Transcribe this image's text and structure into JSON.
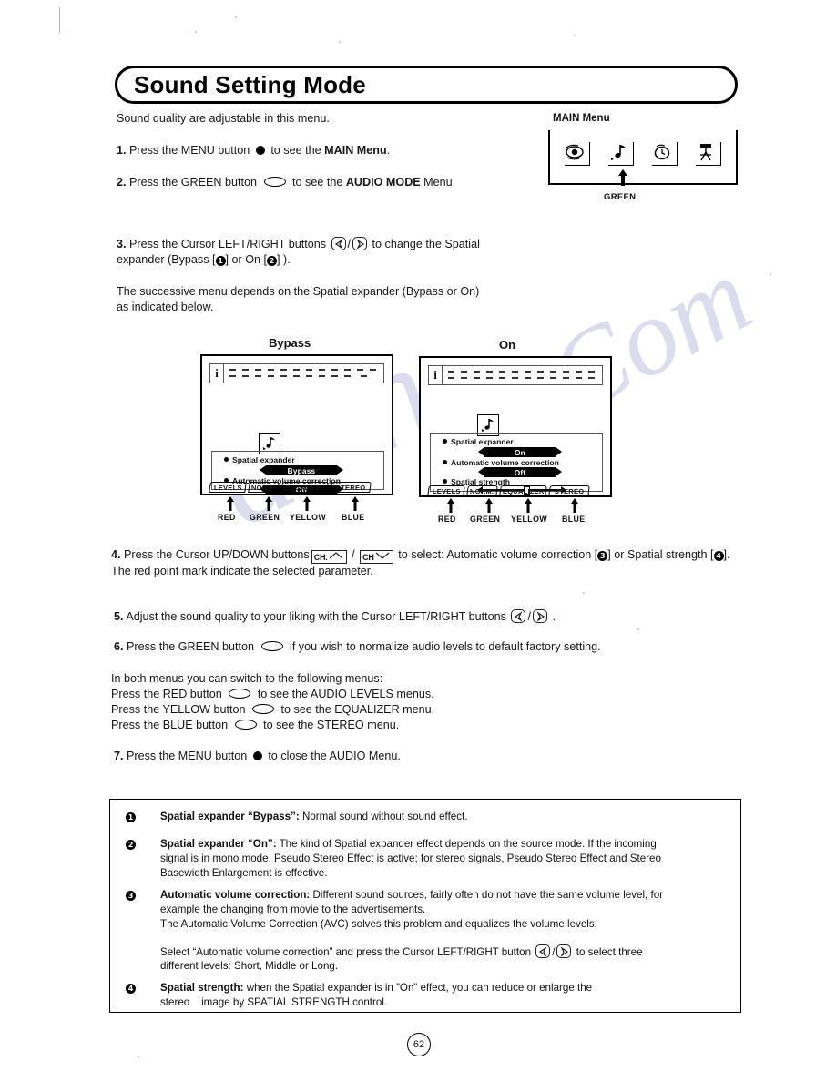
{
  "page": {
    "title": "Sound Setting Mode",
    "page_number": "62",
    "intro": "Sound quality are adjustable in this menu."
  },
  "steps": [
    {
      "number": "1.",
      "pre": "Press the MENU button",
      "icon": "menu-dot-button",
      "post_plain": " to see the ",
      "post_bold": "MAIN Menu",
      "tail": "."
    },
    {
      "number": "2.",
      "pre": "Press the GREEN button",
      "icon": "oval-button",
      "post_plain": " to see the ",
      "post_bold": "AUDIO MODE",
      "tail": " Menu"
    }
  ],
  "step3": {
    "number": "3.",
    "part1": "Press the Cursor LEFT/RIGHT buttons",
    "part2": "to change the Spatial",
    "line2_a": "expander (Bypass [",
    "line2_b": "] or On [",
    "line2_c": "] )."
  },
  "successive": {
    "line1": "The successive menu depends on the Spatial expander (Bypass or On)",
    "line2": "as indicated below."
  },
  "main_menu_diagram": {
    "label": "MAIN Menu",
    "button_label": "GREEN",
    "icons": [
      "eye-picture-icon",
      "music-note-audio-icon",
      "clock-timer-icon",
      "menu-antenna-icon"
    ]
  },
  "screens": [
    {
      "caption": "Bypass",
      "info_icon": "info-i-icon",
      "note_icon": "music-note-icon",
      "rows": [
        {
          "label": "Spatial expander",
          "value": "Bypass",
          "type": "value"
        },
        {
          "label": "Automatic volume correction",
          "value": "Off",
          "type": "value"
        }
      ],
      "tabs": [
        "LEVELS",
        "NORM.",
        "EQUALIZER",
        "STEREO"
      ],
      "colors": [
        "RED",
        "GREEN",
        "YELLOW",
        "BLUE"
      ]
    },
    {
      "caption": "On",
      "info_icon": "info-i-icon",
      "note_icon": "music-note-icon",
      "rows": [
        {
          "label": "Spatial expander",
          "value": "On",
          "type": "value"
        },
        {
          "label": "Automatic volume correction",
          "value": "Off",
          "type": "value"
        },
        {
          "label": "Spatial strength",
          "value": "",
          "type": "slider",
          "slider_percent": 55
        }
      ],
      "tabs": [
        "LEVELS",
        "NORM.",
        "EQUALIZER",
        "STEREO"
      ],
      "colors": [
        "RED",
        "GREEN",
        "YELLOW",
        "BLUE"
      ]
    }
  ],
  "step4": {
    "number": "4.",
    "part1": "Press the Cursor UP/DOWN buttons",
    "ch_up": "CH.",
    "ch_down": "CH",
    "part2": "to select: Automatic volume correction [",
    "part3": "] or Spatial strength [",
    "part4": "].",
    "line2": "The red point mark indicate the selected parameter."
  },
  "step5": {
    "number": "5.",
    "text": "Adjust the sound quality to your liking with the Cursor LEFT/RIGHT buttons",
    "tail": "."
  },
  "step6": {
    "number": "6.",
    "pre": "Press the GREEN button",
    "post": "if you wish to normalize audio levels to default factory setting."
  },
  "switch_block": {
    "intro": "In both menus you can switch to the following menus:",
    "lines": [
      {
        "pre": "Press the RED button",
        "post": "to see the AUDIO LEVELS menus."
      },
      {
        "pre": "Press the YELLOW button",
        "post": "to see the EQUALIZER menu."
      },
      {
        "pre": "Press the BLUE button",
        "post": "to see the STEREO menu."
      }
    ]
  },
  "step7": {
    "number": "7.",
    "pre": "Press the MENU button",
    "post": "to close the AUDIO Menu."
  },
  "notes": [
    {
      "marker": "1",
      "bold": "Spatial expander “Bypass”:",
      "lines": [
        "Normal sound without sound effect."
      ]
    },
    {
      "marker": "2",
      "bold": "Spatial expander “On”:",
      "lines": [
        "The kind of Spatial expander effect depends on the source mode. If the incoming",
        "signal is in mono mode, Pseudo Stereo Effect is active; for stereo signals, Pseudo Stereo Effect and Stereo",
        "Basewidth Enlargement is effective."
      ]
    },
    {
      "marker": "3",
      "bold": "Automatic volume correction:",
      "lines": [
        "Different sound sources, fairly often do not have the same volume level, for",
        "example the changing from movie to the advertisements.",
        "The Automatic Volume Correction (AVC) solves this problem and equalizes the volume levels."
      ],
      "extra_lines": [
        "Select “Automatic volume correction” and press the Cursor LEFT/RIGHT button",
        "different levels: Short, Middle or Long."
      ],
      "extra_tail": "to select three"
    },
    {
      "marker": "4",
      "bold": "Spatial strength:",
      "lines": [
        "when the Spatial expander is in ”On” effect, you can reduce or enlarge the",
        "stereo    image by SPATIAL STRENGTH control."
      ]
    }
  ],
  "colors": {
    "ink": "#111111",
    "watermark": "#c9cbe6"
  }
}
